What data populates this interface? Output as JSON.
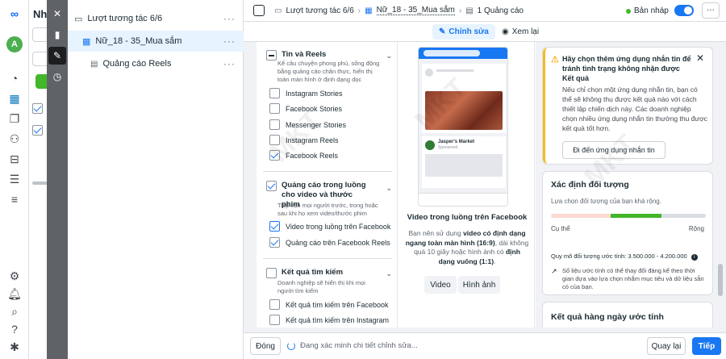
{
  "rail": {
    "avatar_letter": "A"
  },
  "leftpanel": {
    "title_fragment": "Nh"
  },
  "tree": {
    "items": [
      {
        "label": "Lượt tương tác 6/6",
        "icon": "folder-icon"
      },
      {
        "label": "Nữ_18 - 35_Mua sắm",
        "icon": "grid-icon"
      },
      {
        "label": "Quảng cáo Reels",
        "icon": "ad-icon"
      }
    ]
  },
  "topbar": {
    "crumb_campaign": "Lượt tương tác 6/6",
    "crumb_adset": "Nữ_18 - 35_Mua sắm",
    "crumb_ad": "1 Quảng cáo",
    "status": "Bản nháp"
  },
  "subbar": {
    "edit_label": "Chỉnh sửa",
    "review_label": "Xem lại"
  },
  "placements": {
    "reels": {
      "title": "Tin và Reels",
      "desc": "Kể câu chuyện phong phú, sống động bằng quảng cáo chân thực, hiển thị toàn màn hình ở định dạng dọc",
      "options": [
        {
          "label": "Instagram Stories",
          "checked": false
        },
        {
          "label": "Facebook Stories",
          "checked": false
        },
        {
          "label": "Messenger Stories",
          "checked": false
        },
        {
          "label": "Instagram Reels",
          "checked": false
        },
        {
          "label": "Facebook Reels",
          "checked": true
        }
      ]
    },
    "instream": {
      "title": "Quảng cáo trong luồng cho video và thước phim",
      "desc": "Tiếp cận mọi người trước, trong hoặc sau khi họ xem video/thước phim",
      "options": [
        {
          "label": "Video trong luồng trên Facebook",
          "checked": true
        },
        {
          "label": "Quảng cáo trên Facebook Reels",
          "checked": true
        }
      ]
    },
    "search": {
      "title": "Kết quả tìm kiếm",
      "desc": "Doanh nghiệp sẽ hiển thị khi mọi người tìm kiếm",
      "options": [
        {
          "label": "Kết quả tìm kiếm trên Facebook",
          "checked": false
        },
        {
          "label": "Kết quả tìm kiếm trên Instagram",
          "checked": false
        }
      ]
    }
  },
  "preview": {
    "caption": "Video trong luồng trên Facebook",
    "desc_prefix": "Bạn nên sử dụng ",
    "desc_bold1": "video có định dạng ngang toàn màn hình (16:9)",
    "desc_mid": ", dài không quá 10 giây hoặc hình ảnh có ",
    "desc_bold2": "định dạng vuông (1:1)",
    "desc_suffix": ".",
    "tab_video": "Video",
    "tab_image": "Hình ảnh",
    "post_name": "Jasper's Market",
    "post_sub": "Sponsored"
  },
  "warning": {
    "title": "Hãy chọn thêm ứng dụng nhắn tin để tránh tình trạng không nhận được Kết quả",
    "body": "Nếu chỉ chọn một ứng dụng nhắn tin, bạn có thể sẽ không thu được kết quả nào với cách thiết lập chiến dịch này. Các doanh nghiệp chọn nhiều ứng dụng nhắn tin thường thu được kết quả tốt hơn.",
    "button": "Đi đến ứng dụng nhắn tin"
  },
  "audience": {
    "title": "Xác định đối tượng",
    "subtitle": "Lựa chọn đối tượng của bạn khá rộng.",
    "label_specific": "Cụ thể",
    "label_broad": "Rộng",
    "level": 0.55,
    "estimate": "Quy mô đối tượng ước tính: 3.500.000 - 4.200.000",
    "note": "Số liệu ước tính có thể thay đổi đáng kể theo thời gian dựa vào lựa chọn nhắm mục tiêu và dữ liệu sẵn có của bạn."
  },
  "daily": {
    "title": "Kết quả hàng ngày ước tính"
  },
  "bottom": {
    "close": "Đóng",
    "status": "Đang xác minh chi tiết chỉnh sửa...",
    "back": "Quay lại",
    "next": "Tiếp"
  },
  "colors": {
    "accent": "#1877f2",
    "status_green": "#42b72a",
    "warning_bg": "#fff8e1"
  }
}
